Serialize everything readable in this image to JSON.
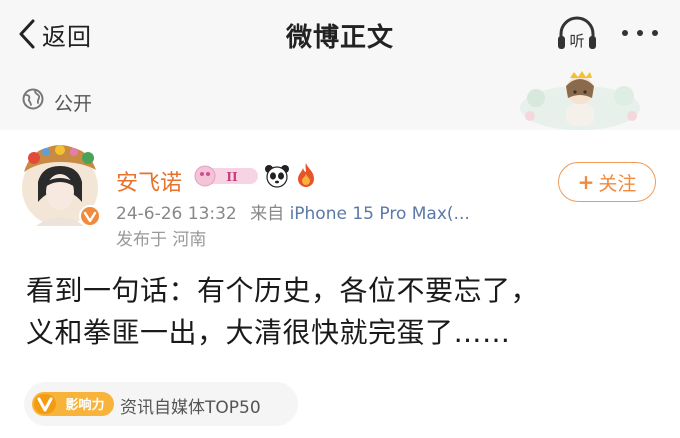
{
  "header": {
    "back_label": "返回",
    "title": "微博正文",
    "listen_label": "听"
  },
  "visibility": {
    "label": "公开"
  },
  "author": {
    "name": "安飞诺",
    "level_badge": "II"
  },
  "post": {
    "timestamp": "24-6-26 13:32",
    "source": "来自",
    "device": "iPhone 15 Pro Max(...",
    "location": "发布于 河南",
    "lines": [
      "看到一句话：有个历史，各位不要忘了，",
      "义和拳匪一出，大清很快就完蛋了……"
    ]
  },
  "follow": {
    "plus": "+",
    "label": "关注"
  },
  "influence": {
    "badge_text": "影响力",
    "label": "资讯自媒体TOP50"
  },
  "colors": {
    "accent_orange": "#f08a3c",
    "author_orange": "#e8722b",
    "link_blue": "#5a78a8",
    "bar_bg": "#f7f7f7"
  },
  "icons": {
    "back": "chevron-left-icon",
    "listen": "headphones-icon",
    "more": "more-dots-icon",
    "visibility": "globe-icon",
    "panda": "panda-icon",
    "fire": "fire-icon"
  }
}
